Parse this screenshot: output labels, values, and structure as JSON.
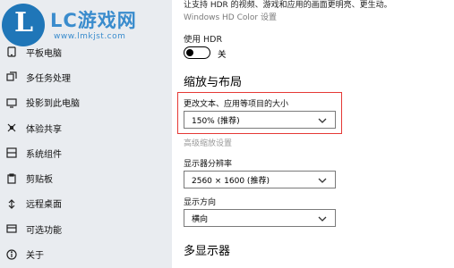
{
  "logo": {
    "letter": "L",
    "title": "LC游戏网",
    "subtitle": "www.lmkjst.com"
  },
  "sidebar": {
    "items": [
      {
        "label": "平板电脑",
        "icon": "tablet-icon"
      },
      {
        "label": "多任务处理",
        "icon": "multitask-icon"
      },
      {
        "label": "投影到此电脑",
        "icon": "project-icon"
      },
      {
        "label": "体验共享",
        "icon": "share-icon"
      },
      {
        "label": "系统组件",
        "icon": "components-icon"
      },
      {
        "label": "剪贴板",
        "icon": "clipboard-icon"
      },
      {
        "label": "远程桌面",
        "icon": "remote-desktop-icon"
      },
      {
        "label": "可选功能",
        "icon": "optional-features-icon"
      },
      {
        "label": "关于",
        "icon": "info-icon"
      }
    ]
  },
  "main": {
    "top_text": "让支持 HDR 的视频、游戏和应用的画面更明亮、更生动。",
    "hd_color_link": "Windows HD Color 设置",
    "hdr_label": "使用 HDR",
    "hdr_state": "关",
    "scale_section_title": "缩放与布局",
    "scale_label": "更改文本、应用等项目的大小",
    "scale_value": "150% (推荐)",
    "advanced_scaling_link": "高级缩放设置",
    "resolution_label": "显示器分辨率",
    "resolution_value": "2560 × 1600 (推荐)",
    "orientation_label": "显示方向",
    "orientation_value": "横向",
    "multi_display_title": "多显示器"
  },
  "colors": {
    "highlight_border": "#e53935",
    "sidebar_bg": "#e9ecf0",
    "logo_blue": "#3a8ccd"
  }
}
